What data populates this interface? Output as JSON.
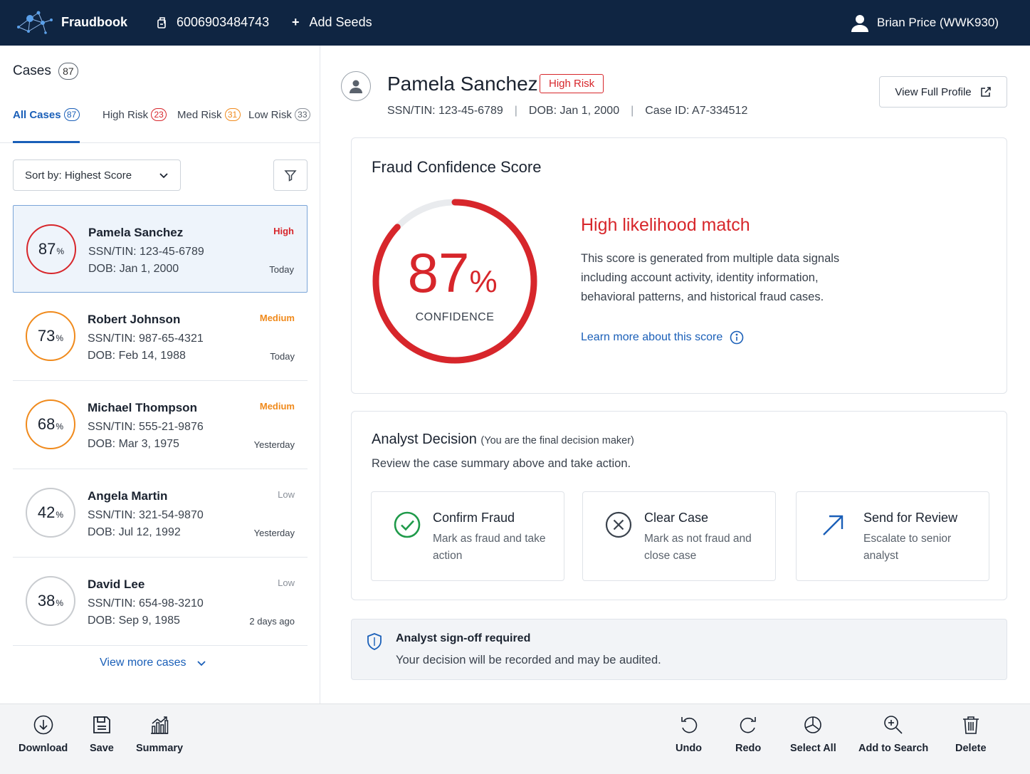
{
  "header": {
    "brand": "Fraudbook",
    "account_number": "6006903484743",
    "add_seeds_label": "Add Seeds",
    "user_name": "Brian Price (WWK930)"
  },
  "sidebar": {
    "title": "Cases",
    "total_count": "87",
    "tabs": [
      {
        "label": "All Cases",
        "count": "87"
      },
      {
        "label": "High Risk",
        "count": "23"
      },
      {
        "label": "Med Risk",
        "count": "31"
      },
      {
        "label": "Low Risk",
        "count": "33"
      }
    ],
    "sort_label": "Sort by: Highest Score",
    "cases": [
      {
        "score": "87",
        "name": "Pamela Sanchez",
        "ssn": "SSN/TIN:  123-45-6789",
        "dob": "DOB:  Jan 1, 2000",
        "risk": "High",
        "time": "Today"
      },
      {
        "score": "73",
        "name": "Robert Johnson",
        "ssn": "SSN/TIN:  987-65-4321",
        "dob": "DOB:  Feb 14, 1988",
        "risk": "Medium",
        "time": "Today"
      },
      {
        "score": "68",
        "name": "Michael Thompson",
        "ssn": "SSN/TIN:  555-21-9876",
        "dob": "DOB:  Mar 3, 1975",
        "risk": "Medium",
        "time": "Yesterday"
      },
      {
        "score": "42",
        "name": "Angela Martin",
        "ssn": "SSN/TIN:  321-54-9870",
        "dob": "DOB:  Jul 12, 1992",
        "risk": "Low",
        "time": "Yesterday"
      },
      {
        "score": "38",
        "name": "David Lee",
        "ssn": "SSN/TIN:  654-98-3210",
        "dob": "DOB:  Sep 9, 1985",
        "risk": "Low",
        "time": "2 days ago"
      }
    ],
    "percent_sign": "%",
    "view_more_label": "View more cases"
  },
  "profile": {
    "name": "Pamela Sanchez",
    "risk_tag": "High Risk",
    "ssn": "SSN/TIN:  123-45-6789",
    "dob": "DOB:  Jan 1, 2000",
    "case_id": "Case ID:  A7-334512",
    "separator": "|",
    "view_profile_label": "View Full Profile"
  },
  "score": {
    "title": "Fraud Confidence Score",
    "value": "87",
    "fraction": 0.87,
    "percent_sign": "%",
    "caption": "CONFIDENCE",
    "likelihood": "High likelihood match",
    "description": "This score is generated from multiple data signals including account activity, identity information, behavioral patterns, and historical fraud cases.",
    "learn_more": "Learn more about this score"
  },
  "decision": {
    "title": "Analyst Decision",
    "note": "(You are the final decision maker)",
    "subtitle": "Review the case summary above and take action.",
    "actions": [
      {
        "title": "Confirm Fraud",
        "desc": "Mark as fraud and take action"
      },
      {
        "title": "Clear Case",
        "desc": "Mark as not fraud and close case"
      },
      {
        "title": "Send for Review",
        "desc": "Escalate to senior analyst"
      }
    ]
  },
  "signoff": {
    "title": "Analyst sign-off required",
    "text": "Your decision will be recorded and may be audited."
  },
  "toolbar": {
    "download": "Download",
    "save": "Save",
    "summary": "Summary",
    "undo": "Undo",
    "redo": "Redo",
    "select_all": "Select All",
    "add_to_search": "Add to Search",
    "delete": "Delete"
  },
  "colors": {
    "navy": "#0f2542",
    "high": "#d7262b",
    "medium": "#f08a1c",
    "low": "#c9ccd0",
    "accent": "#1a5fb8",
    "confirm": "#1f9a4a"
  },
  "icons": {
    "logo": "network-logo-icon",
    "account": "account-card-icon",
    "user": "user-icon",
    "filter": "filter-icon",
    "external": "external-link-icon",
    "info": "info-icon",
    "check": "check-circle-icon",
    "x": "x-circle-icon",
    "arrow": "arrow-up-right-icon",
    "shield": "shield-icon"
  }
}
